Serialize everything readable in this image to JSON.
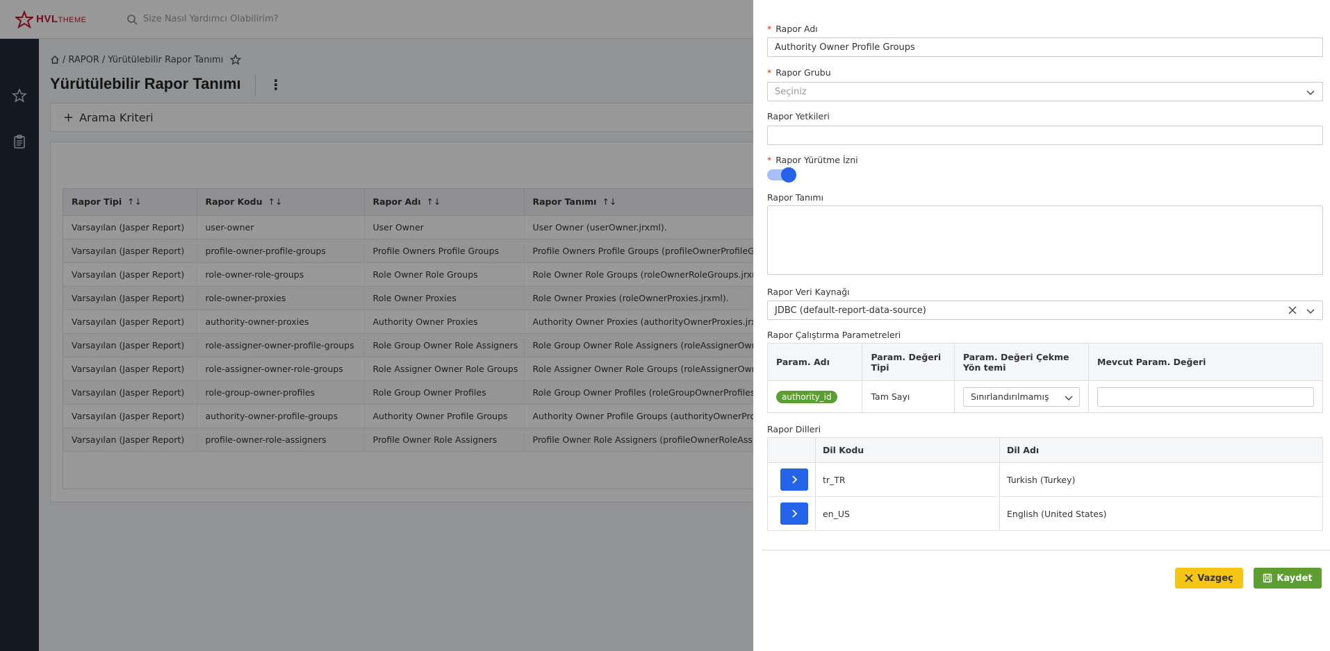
{
  "header": {
    "logo_text": "HVL",
    "logo_suffix": "THEME",
    "search_placeholder": "Size Nasıl Yardımcı Olabilirim?"
  },
  "sidebar": {
    "icons": [
      "star-icon",
      "clipboard-icon"
    ]
  },
  "breadcrumb": {
    "sep1": "/",
    "item1": "RAPOR",
    "sep2": "/",
    "item2": "Yürütülebilir Rapor Tanımı"
  },
  "page": {
    "title": "Yürütülebilir Rapor Tanımı",
    "search_criteria": "Arama Kriteri"
  },
  "table": {
    "columns": [
      "Rapor Tipi",
      "Rapor Kodu",
      "Rapor Adı",
      "Rapor Tanımı"
    ],
    "rows": [
      [
        "Varsayılan (Jasper Report)",
        "user-owner",
        "User Owner",
        "User Owner (userOwner.jrxml)."
      ],
      [
        "Varsayılan (Jasper Report)",
        "profile-owner-profile-groups",
        "Profile Owners Profile Groups",
        "Profile Owners Profile Groups (profileOwnerProfileGroups"
      ],
      [
        "Varsayılan (Jasper Report)",
        "role-owner-role-groups",
        "Role Owner Role Groups",
        "Role Owner Role Groups (roleOwnerRoleGroups.jrxml)."
      ],
      [
        "Varsayılan (Jasper Report)",
        "role-owner-proxies",
        "Role Owner Proxies",
        "Role Owner Proxies (roleOwnerProxies.jrxml)."
      ],
      [
        "Varsayılan (Jasper Report)",
        "authority-owner-proxies",
        "Authority Owner Proxies",
        "Authority Owner Proxies (authorityOwnerProxies.jrxml)."
      ],
      [
        "Varsayılan (Jasper Report)",
        "role-assigner-owner-profile-groups",
        "Role Group Owner Role Assigners",
        "Role Group Owner Role Assigners (roleAssignerOwnerPro"
      ],
      [
        "Varsayılan (Jasper Report)",
        "role-assigner-owner-role-groups",
        "Role Assigner Owner Role Groups",
        "Role Assigner Owner Role Groups (roleAssignerOwnerRole"
      ],
      [
        "Varsayılan (Jasper Report)",
        "role-group-owner-profiles",
        "Role Group Owner Profiles",
        "Role Group Owner Profiles (roleGroupOwnerProfiles.jrxml"
      ],
      [
        "Varsayılan (Jasper Report)",
        "authority-owner-profile-groups",
        "Authority Owner Profile Groups",
        "Authority Owner Profile Groups (authorityOwnerProfileGr"
      ],
      [
        "Varsayılan (Jasper Report)",
        "profile-owner-role-assigners",
        "Profile Owner Role Assigners",
        "Profile Owner Role Assigners (profileOwnerRoleAssigners."
      ]
    ]
  },
  "form": {
    "rapor_adi_label": "Rapor Adı",
    "rapor_adi_value": "Authority Owner Profile Groups",
    "rapor_grubu_label": "Rapor Grubu",
    "rapor_grubu_placeholder": "Seçiniz",
    "rapor_yetkileri_label": "Rapor Yetkileri",
    "yurutme_izni_label": "Rapor Yürütme İzni",
    "yurutme_izni_on": true,
    "rapor_tanimi_label": "Rapor Tanımı",
    "veri_kaynagi_label": "Rapor Veri Kaynağı",
    "veri_kaynagi_value": "JDBC (default-report-data-source)",
    "parametreler_label": "Rapor Çalıştırma Parametreleri",
    "param_columns": [
      "Param. Adı",
      "Param. Değeri Tipi",
      "Param. Değeri Çekme Yön temi",
      "Mevcut Param. Değeri"
    ],
    "param_row": {
      "name": "authority_id",
      "type": "Tam Sayı",
      "method": "Sınırlandırılmamış",
      "value": ""
    },
    "diller_label": "Rapor Dilleri",
    "lang_columns": [
      "Dil Kodu",
      "Dil Adı"
    ],
    "languages": [
      {
        "code": "tr_TR",
        "name": "Turkish (Turkey)"
      },
      {
        "code": "en_US",
        "name": "English (United States)"
      }
    ],
    "cancel_label": "Vazgeç",
    "save_label": "Kaydet"
  },
  "colors": {
    "brand": "#c8102e",
    "primary": "#2563eb",
    "success": "#5c9e31",
    "warning": "#f5c518",
    "sidebar": "#1f2a3a"
  }
}
